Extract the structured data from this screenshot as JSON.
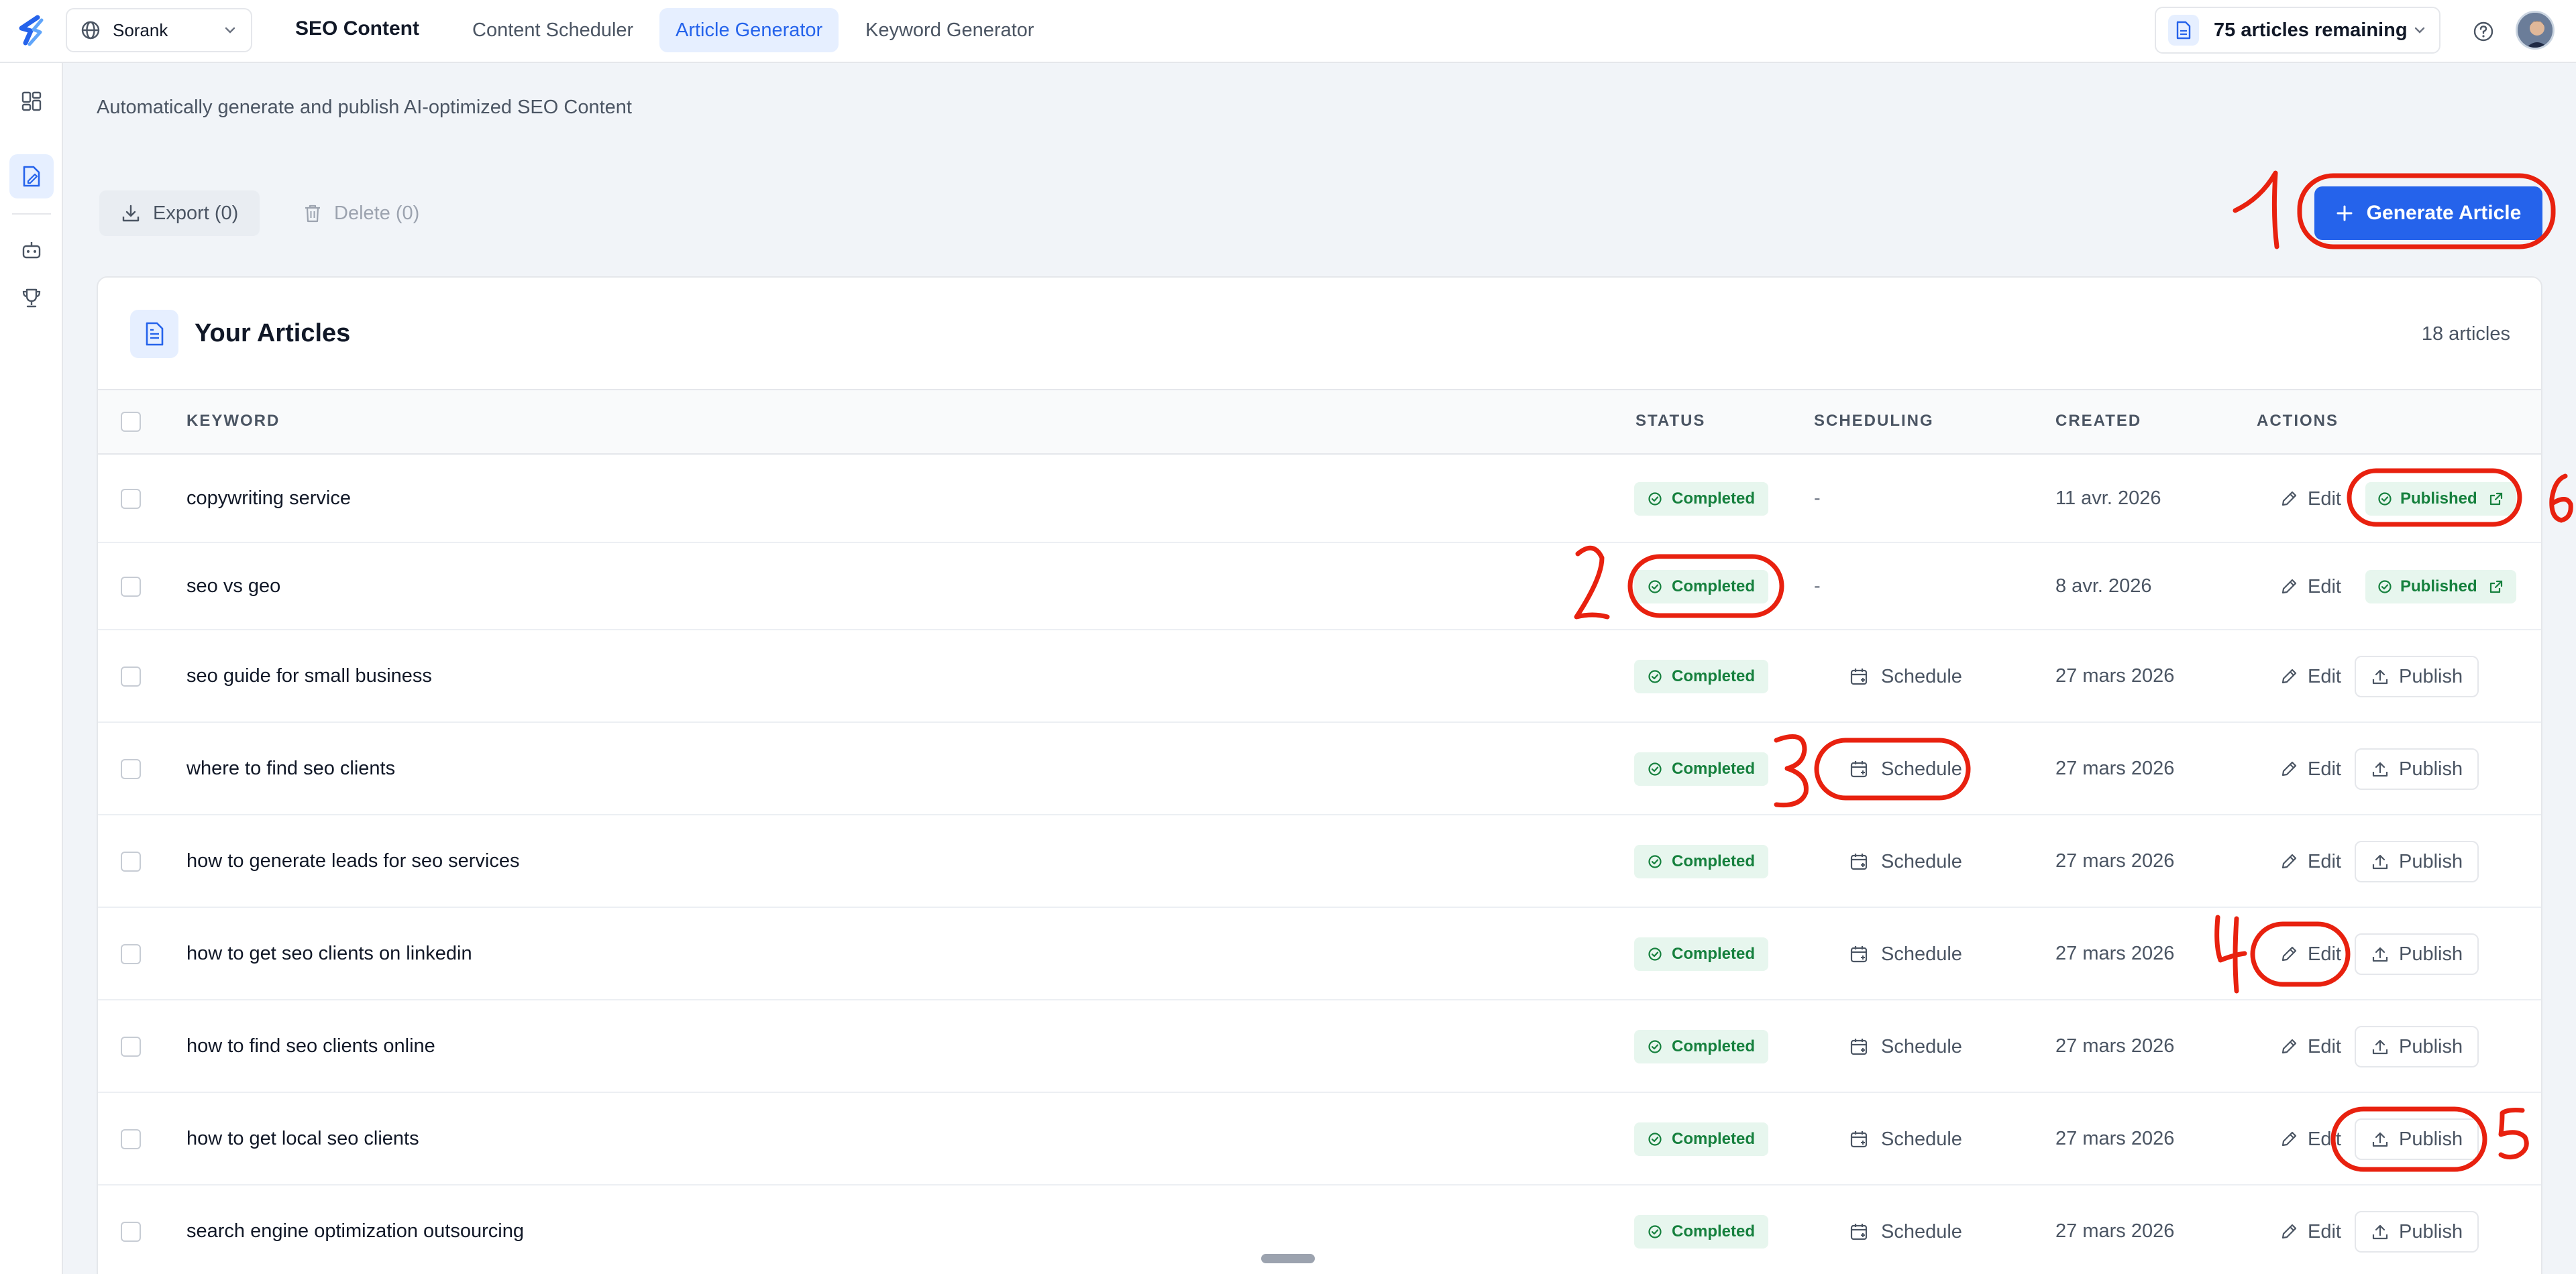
{
  "topbar": {
    "site_name": "Sorank",
    "brand_title": "SEO Content",
    "tabs": [
      {
        "label": "Content Scheduler",
        "active": false
      },
      {
        "label": "Article Generator",
        "active": true
      },
      {
        "label": "Keyword Generator",
        "active": false
      }
    ],
    "credits_label": "75 articles remaining"
  },
  "rail": {
    "items": [
      "dashboard-icon",
      "article-icon",
      "robot-icon",
      "trophy-icon"
    ]
  },
  "main": {
    "subtitle": "Automatically generate and publish AI-optimized SEO Content",
    "export_label": "Export (0)",
    "delete_label": "Delete (0)",
    "generate_label": "Generate Article"
  },
  "articles": {
    "title": "Your Articles",
    "count": "18 articles",
    "columns": {
      "keyword": "KEYWORD",
      "status": "STATUS",
      "scheduling": "SCHEDULING",
      "created": "CREATED",
      "actions": "ACTIONS"
    },
    "edit_label": "Edit",
    "publish_label": "Publish",
    "schedule_label": "Schedule",
    "published_label": "Published",
    "rows": [
      {
        "keyword": "copywriting service",
        "status": "Completed",
        "scheduling": "-",
        "created": "11 avr. 2026",
        "published": true
      },
      {
        "keyword": "seo vs geo",
        "status": "Completed",
        "scheduling": "-",
        "created": "8 avr. 2026",
        "published": true
      },
      {
        "keyword": "seo guide for small business",
        "status": "Completed",
        "scheduling": "Schedule",
        "created": "27 mars 2026",
        "published": false
      },
      {
        "keyword": "where to find seo clients",
        "status": "Completed",
        "scheduling": "Schedule",
        "created": "27 mars 2026",
        "published": false
      },
      {
        "keyword": "how to generate leads for seo services",
        "status": "Completed",
        "scheduling": "Schedule",
        "created": "27 mars 2026",
        "published": false
      },
      {
        "keyword": "how to get seo clients on linkedin",
        "status": "Completed",
        "scheduling": "Schedule",
        "created": "27 mars 2026",
        "published": false
      },
      {
        "keyword": "how to find seo clients online",
        "status": "Completed",
        "scheduling": "Schedule",
        "created": "27 mars 2026",
        "published": false
      },
      {
        "keyword": "how to get local seo clients",
        "status": "Completed",
        "scheduling": "Schedule",
        "created": "27 mars 2026",
        "published": false
      },
      {
        "keyword": "search engine optimization outsourcing",
        "status": "Completed",
        "scheduling": "Schedule",
        "created": "27 mars 2026",
        "published": false
      }
    ]
  },
  "annotations": [
    "1",
    "2",
    "3",
    "4",
    "5",
    "6"
  ],
  "colors": {
    "accent": "#2563eb",
    "success": "#15803d",
    "success_bg": "#e7f6ee",
    "annotation": "#e8210f"
  }
}
